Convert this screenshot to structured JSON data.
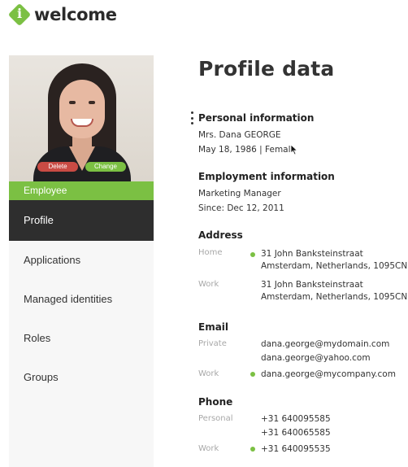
{
  "header": {
    "logo_text": "welcome",
    "logo_glyph": "i"
  },
  "sidebar": {
    "photo_buttons": {
      "delete": "Delete",
      "change": "Change"
    },
    "role": "Employee",
    "items": [
      {
        "label": "Profile",
        "active": true
      },
      {
        "label": "Applications"
      },
      {
        "label": "Managed identities"
      },
      {
        "label": "Roles"
      },
      {
        "label": "Groups"
      }
    ]
  },
  "main": {
    "title": "Profile data",
    "personal": {
      "title": "Personal information",
      "name": "Mrs. Dana GEORGE",
      "birth_line": "May 18, 1986  |  Female"
    },
    "employment": {
      "title": "Employment information",
      "position": "Marketing Manager",
      "since": "Since: Dec 12, 2011"
    },
    "address": {
      "title": "Address",
      "home_label": "Home",
      "home_line1": "31 John Banksteinstraat",
      "home_line2": "Amsterdam, Netherlands, 1095CN",
      "work_label": "Work",
      "work_line1": "31 John Banksteinstraat",
      "work_line2": "Amsterdam, Netherlands, 1095CN"
    },
    "email": {
      "title": "Email",
      "private_label": "Private",
      "private_1": "dana.george@mydomain.com",
      "private_2": "dana.george@yahoo.com",
      "work_label": "Work",
      "work_1": "dana.george@mycompany.com"
    },
    "phone": {
      "title": "Phone",
      "personal_label": "Personal",
      "personal_1": "+31 640095585",
      "personal_2": "+31 640065585",
      "work_label": "Work",
      "work_1": "+31 640095535"
    }
  },
  "colors": {
    "accent": "#7bc043",
    "danger": "#c94b44",
    "nav_active": "#2e2e2e"
  }
}
